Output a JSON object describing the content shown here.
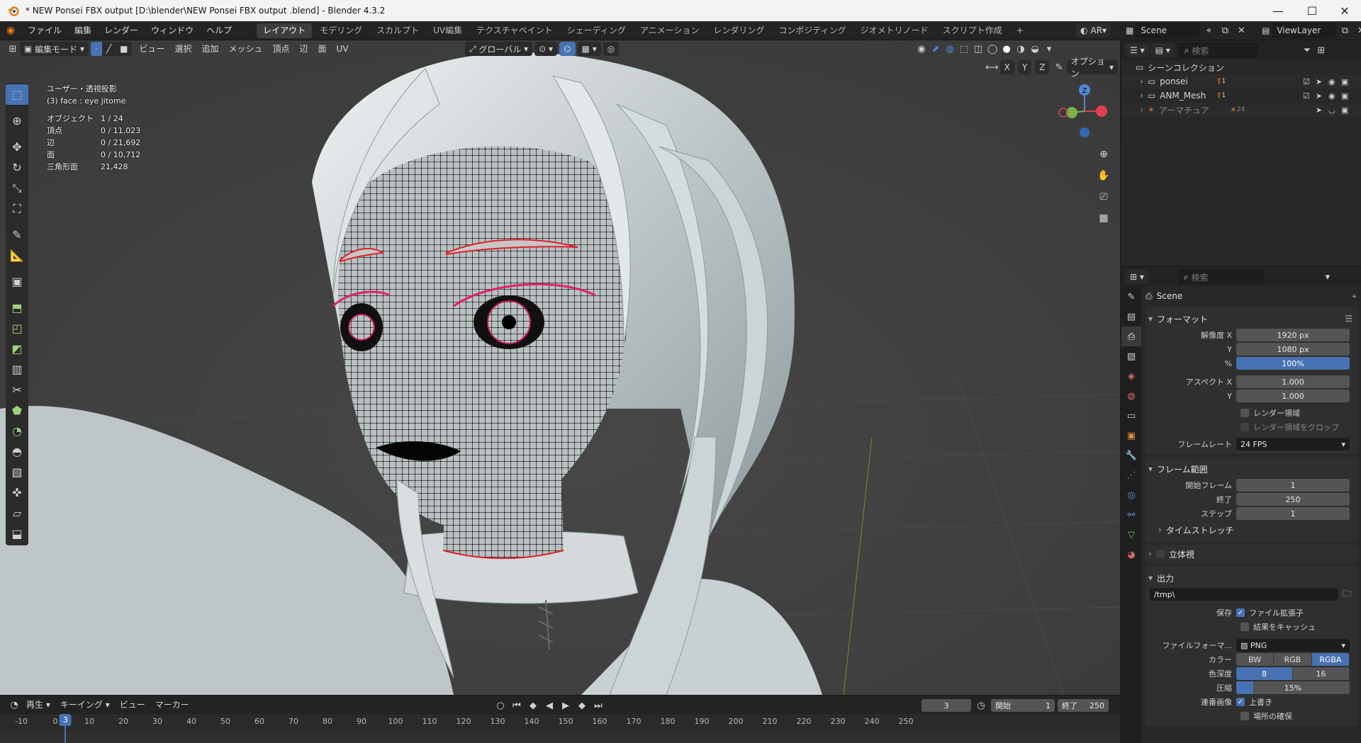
{
  "titlebar": {
    "title": "* NEW   Ponsei   FBX output  [D:\\blender\\NEW   Ponsei   FBX output .blend] - Blender 4.3.2"
  },
  "menu": [
    "ファイル",
    "編集",
    "レンダー",
    "ウィンドウ",
    "ヘルプ"
  ],
  "workspaces": [
    "レイアウト",
    "モデリング",
    "スカルプト",
    "UV編集",
    "テクスチャペイント",
    "シェーディング",
    "アニメーション",
    "レンダリング",
    "コンポジティング",
    "ジオメトリノード",
    "スクリプト作成"
  ],
  "active_workspace": "レイアウト",
  "scene_field": "Scene",
  "viewlayer_field": "ViewLayer",
  "ar_label": "AR",
  "viewport_header": {
    "mode": "編集モード",
    "menus": [
      "ビュー",
      "選択",
      "追加",
      "メッシュ",
      "頂点",
      "辺",
      "面",
      "UV"
    ],
    "transform_orientation": "グローバル",
    "options": "オプション",
    "axes": [
      "X",
      "Y",
      "Z"
    ]
  },
  "stats": {
    "view_name": "ユーザー・透視投影",
    "object_name": "(3) face : eye jitome",
    "rows": [
      {
        "label": "オブジェクト",
        "value": "1 / 24"
      },
      {
        "label": "頂点",
        "value": "0 / 11,023"
      },
      {
        "label": "辺",
        "value": "0 / 21,692"
      },
      {
        "label": "面",
        "value": "0 / 10,712"
      },
      {
        "label": "三角形面",
        "value": "21,428"
      }
    ]
  },
  "gizmo": {
    "z": "Z"
  },
  "timeline": {
    "menus": [
      "再生",
      "キーイング",
      "ビュー",
      "マーカー"
    ],
    "current_frame": "3",
    "start_label": "開始",
    "start_value": "1",
    "end_label": "終了",
    "end_value": "250",
    "ticks": [
      "-10",
      "0",
      "10",
      "20",
      "30",
      "40",
      "50",
      "60",
      "70",
      "80",
      "90",
      "100",
      "110",
      "120",
      "130",
      "140",
      "150",
      "160",
      "170",
      "180",
      "190",
      "200",
      "210",
      "220",
      "230",
      "240",
      "250"
    ]
  },
  "outliner": {
    "search_placeholder": "検索",
    "root": "シーンコレクション",
    "items": [
      {
        "name": "ponsei",
        "badge": "1"
      },
      {
        "name": "ANM_Mesh",
        "badge": "1"
      },
      {
        "name": "アーマチュア",
        "badge": "24"
      }
    ]
  },
  "properties": {
    "search_placeholder": "検索",
    "context": "Scene",
    "format_panel": "フォーマット",
    "resolution_x_label": "解像度 X",
    "resolution_x": "1920 px",
    "y_label": "Y",
    "resolution_y": "1080 px",
    "percent_label": "%",
    "percent": "100%",
    "aspect_x_label": "アスペクト X",
    "aspect_x": "1.000",
    "aspect_y": "1.000",
    "render_region": "レンダー領域",
    "crop_region": "レンダー領域をクロップ",
    "framerate_label": "フレームレート",
    "framerate": "24 FPS",
    "frame_range_panel": "フレーム範囲",
    "frame_start_label": "開始フレーム",
    "frame_start": "1",
    "frame_end_label": "終了",
    "frame_end": "250",
    "frame_step_label": "ステップ",
    "frame_step": "1",
    "time_stretch": "タイムストレッチ",
    "stereo": "立体視",
    "output_panel": "出力",
    "output_path": "/tmp\\",
    "save_label": "保存",
    "file_ext": "ファイル拡張子",
    "cache_result": "結果をキャッシュ",
    "file_format_label": "ファイルフォーマ...",
    "file_format": "PNG",
    "color_label": "カラー",
    "color_modes": [
      "BW",
      "RGB",
      "RGBA"
    ],
    "color_active": "RGBA",
    "depth_label": "色深度",
    "depth_modes": [
      "8",
      "16"
    ],
    "compression_label": "圧縮",
    "compression": "15%",
    "compression_value": 0.15,
    "sequence_label": "連番画像",
    "overwrite": "上書き",
    "placeholders": "場所の確保"
  },
  "colors": {
    "accent": "#4772b3",
    "bg": "#3f3f3f",
    "panel": "#282828"
  }
}
